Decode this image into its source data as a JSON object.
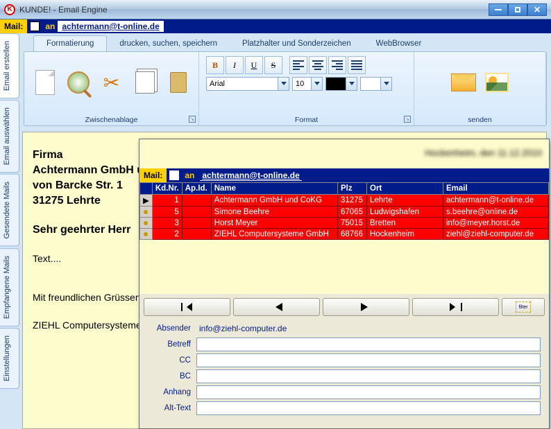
{
  "window": {
    "title": "KUNDE! - Email Engine",
    "icon_letter": "K"
  },
  "top_mailbar": {
    "mail": "Mail:",
    "an": "an",
    "email": "achtermann@t-online.de"
  },
  "side_tabs": [
    "Email erstellen",
    "Email auswählen",
    "Gesendete Mails",
    "Empfangene Mails",
    "Einstellungen"
  ],
  "ribbon": {
    "tabs": [
      "Formatierung",
      "drucken, suchen, speichern",
      "Platzhalter und Sonderzeichen",
      "WebBrowser"
    ],
    "groups": {
      "clipboard": "Zwischenablage",
      "format": "Format",
      "send": "senden"
    },
    "font": "Arial",
    "size": "10"
  },
  "doc": {
    "line1": "Firma",
    "line2": "Achtermann GmbH und CoKG",
    "line3": "von Barcke Str. 1",
    "line4": "31275 Lehrte",
    "greet": "Sehr geehrter Herr",
    "body": "Text....",
    "closing": "Mit freundlichen Grüssen",
    "signature": "ZIEHL Computersysteme"
  },
  "dialog": {
    "blurred": "Hockenheim, den 11.12.2010",
    "mailbar": {
      "mail": "Mail:",
      "an": "an",
      "email": "achtermann@t-online.de"
    },
    "headers": [
      "",
      "Kd.Nr.",
      "Ap.Id.",
      "Name",
      "Plz",
      "Ort",
      "Email"
    ],
    "rows": [
      {
        "ind": "▶",
        "kd": "1",
        "ap": "",
        "name": "Achtermann GmbH und CoKG",
        "plz": "31275",
        "ort": "Lehrte",
        "email": "achtermann@t-online.de"
      },
      {
        "ind": "•",
        "kd": "5",
        "ap": "",
        "name": "Simone Beehre",
        "plz": "67065",
        "ort": "Ludwigshafen",
        "email": "s.beehre@online.de"
      },
      {
        "ind": "•",
        "kd": "3",
        "ap": "",
        "name": "Horst Meyer",
        "plz": "75015",
        "ort": "Bretten",
        "email": "info@meyer.horst.de"
      },
      {
        "ind": "•",
        "kd": "2",
        "ap": "",
        "name": "ZIEHL Computersysteme GmbH",
        "plz": "68766",
        "ort": "Hockenheim",
        "email": "ziehl@ziehl-computer.de"
      }
    ],
    "form": {
      "absender_label": "Absender",
      "absender_value": "info@ziehl-computer.de",
      "betreff_label": "Betreff",
      "betreff_value": "",
      "cc_label": "CC",
      "cc_value": "",
      "bc_label": "BC",
      "bc_value": "",
      "anhang_label": "Anhang",
      "anhang_value": "",
      "alttext_label": "Alt-Text",
      "alttext_value": ""
    },
    "filter_label": "filter"
  }
}
